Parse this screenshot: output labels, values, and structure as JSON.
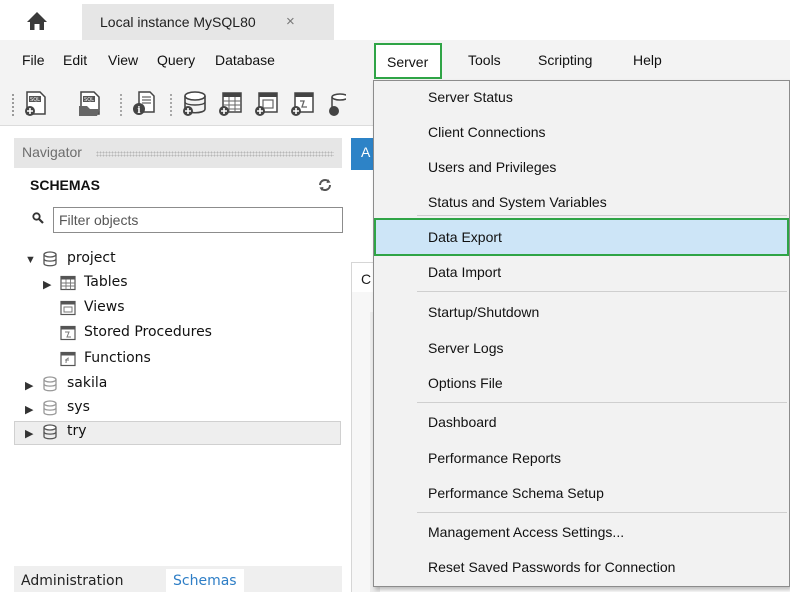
{
  "window": {
    "home_icon": "home-icon",
    "tab_title": "Local instance MySQL80",
    "tab_close": "×"
  },
  "menubar": {
    "items": [
      "File",
      "Edit",
      "View",
      "Query",
      "Database",
      "Server",
      "Tools",
      "Scripting",
      "Help"
    ],
    "open_item": "Server"
  },
  "toolbar": {
    "icons": [
      "new-sql-tab-icon",
      "open-sql-script-icon",
      "inspector-icon",
      "create-schema-icon",
      "create-table-icon",
      "create-view-icon",
      "create-procedure-icon"
    ]
  },
  "navigator": {
    "header": "Navigator",
    "schemas_title": "SCHEMAS",
    "filter_placeholder": "Filter objects",
    "tree": [
      {
        "label": "project",
        "expanded": true
      },
      {
        "label": "Tables"
      },
      {
        "label": "Views"
      },
      {
        "label": "Stored Procedures"
      },
      {
        "label": "Functions"
      },
      {
        "label": "sakila",
        "expanded": false
      },
      {
        "label": "sys",
        "expanded": false
      },
      {
        "label": "try",
        "expanded": false,
        "selected": true
      }
    ],
    "bottom_tabs": [
      "Administration",
      "Schemas"
    ],
    "active_bottom_tab": "Schemas"
  },
  "work_area": {
    "tab_letter": "A",
    "sub_letter": "C"
  },
  "server_menu": {
    "items": [
      "Server Status",
      "Client Connections",
      "Users and Privileges",
      "Status and System Variables",
      "Data Export",
      "Data Import",
      "Startup/Shutdown",
      "Server Logs",
      "Options File",
      "Dashboard",
      "Performance Reports",
      "Performance Schema Setup",
      "Management Access Settings...",
      "Reset Saved Passwords for Connection"
    ],
    "highlighted": "Data Export"
  },
  "colors": {
    "highlight_border": "#2fa446",
    "highlight_fill": "#cde5f7",
    "accent_blue": "#2d83c7"
  }
}
